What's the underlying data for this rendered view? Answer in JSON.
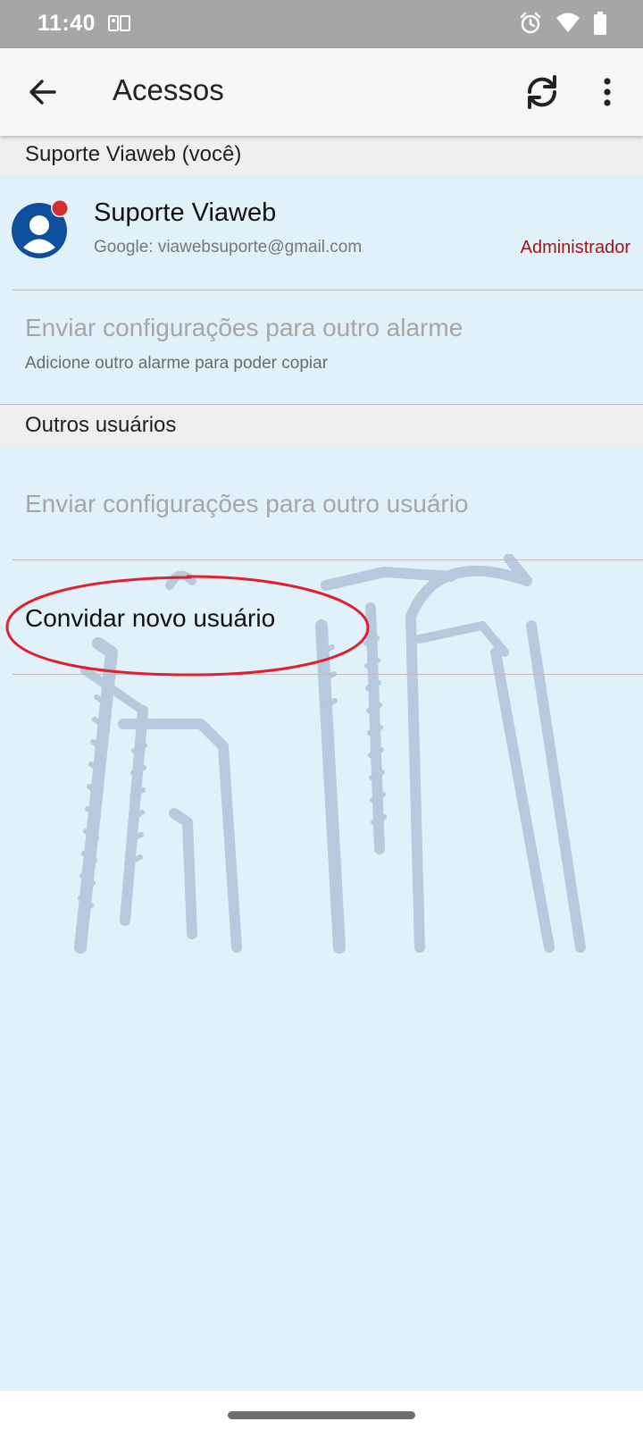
{
  "status_bar": {
    "time": "11:40",
    "left_icon": "gallery-icon",
    "right_icons": [
      "alarm-clock-icon",
      "wifi-icon",
      "battery-icon"
    ]
  },
  "app_bar": {
    "title": "Acessos",
    "back_icon": "arrow-left-icon",
    "sync_icon": "sync-icon",
    "more_icon": "more-vertical-icon"
  },
  "sections": {
    "self_header": "Suporte Viaweb (você)",
    "others_header": "Outros usuários"
  },
  "current_user": {
    "name": "Suporte Viaweb",
    "email": "Google: viawebsuporte@gmail.com",
    "role": "Administrador",
    "avatar_icon": "account-circle-icon",
    "badge_color": "#d32f2f"
  },
  "items": {
    "send_alarm": {
      "title": "Enviar configurações para outro alarme",
      "subtitle": "Adicione outro alarme para poder copiar"
    },
    "send_user": {
      "title": "Enviar configurações para outro usuário"
    },
    "invite": {
      "title": "Convidar novo usuário"
    }
  },
  "colors": {
    "background": "#e1f1fa",
    "app_bar": "#f7f7f7",
    "section_header": "#efefef",
    "role_text": "#a31515",
    "avatar": "#0d4f9c",
    "highlight": "#e0202e",
    "watermark": "#b7c9dc"
  }
}
